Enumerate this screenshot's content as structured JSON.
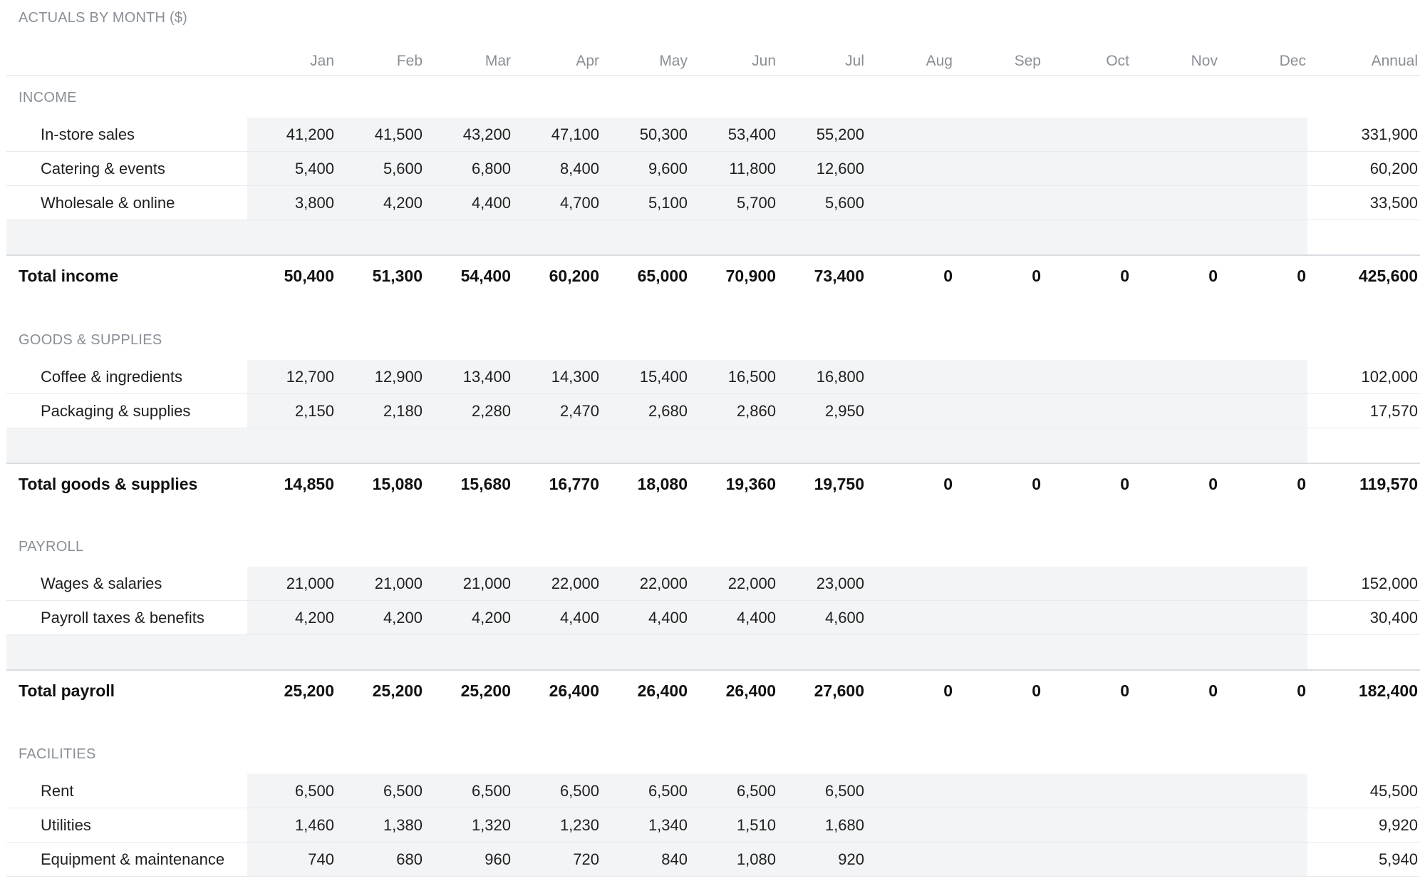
{
  "title": "ACTUALS BY MONTH ($)",
  "columns": [
    "Jan",
    "Feb",
    "Mar",
    "Apr",
    "May",
    "Jun",
    "Jul",
    "Aug",
    "Sep",
    "Oct",
    "Nov",
    "Dec",
    "Annual"
  ],
  "colors": {
    "muted_text": "#8a8f96",
    "input_band": "#f3f4f6",
    "text": "#1f1f1f"
  },
  "sections": [
    {
      "label": "INCOME",
      "rows": [
        {
          "label": "In-store sales",
          "values": [
            "41,200",
            "41,500",
            "43,200",
            "47,100",
            "50,300",
            "53,400",
            "55,200",
            "",
            "",
            "",
            "",
            ""
          ],
          "annual": "331,900"
        },
        {
          "label": "Catering & events",
          "values": [
            "5,400",
            "5,600",
            "6,800",
            "8,400",
            "9,600",
            "11,800",
            "12,600",
            "",
            "",
            "",
            "",
            ""
          ],
          "annual": "60,200"
        },
        {
          "label": "Wholesale & online",
          "values": [
            "3,800",
            "4,200",
            "4,400",
            "4,700",
            "5,100",
            "5,700",
            "5,600",
            "",
            "",
            "",
            "",
            ""
          ],
          "annual": "33,500"
        }
      ],
      "total": {
        "label": "Total income",
        "values": [
          "50,400",
          "51,300",
          "54,400",
          "60,200",
          "65,000",
          "70,900",
          "73,400",
          "0",
          "0",
          "0",
          "0",
          "0"
        ],
        "annual": "425,600"
      }
    },
    {
      "label": "GOODS & SUPPLIES",
      "rows": [
        {
          "label": "Coffee & ingredients",
          "values": [
            "12,700",
            "12,900",
            "13,400",
            "14,300",
            "15,400",
            "16,500",
            "16,800",
            "",
            "",
            "",
            "",
            ""
          ],
          "annual": "102,000"
        },
        {
          "label": "Packaging & supplies",
          "values": [
            "2,150",
            "2,180",
            "2,280",
            "2,470",
            "2,680",
            "2,860",
            "2,950",
            "",
            "",
            "",
            "",
            ""
          ],
          "annual": "17,570"
        }
      ],
      "total": {
        "label": "Total goods & supplies",
        "values": [
          "14,850",
          "15,080",
          "15,680",
          "16,770",
          "18,080",
          "19,360",
          "19,750",
          "0",
          "0",
          "0",
          "0",
          "0"
        ],
        "annual": "119,570"
      }
    },
    {
      "label": "PAYROLL",
      "rows": [
        {
          "label": "Wages & salaries",
          "values": [
            "21,000",
            "21,000",
            "21,000",
            "22,000",
            "22,000",
            "22,000",
            "23,000",
            "",
            "",
            "",
            "",
            ""
          ],
          "annual": "152,000"
        },
        {
          "label": "Payroll taxes & benefits",
          "values": [
            "4,200",
            "4,200",
            "4,200",
            "4,400",
            "4,400",
            "4,400",
            "4,600",
            "",
            "",
            "",
            "",
            ""
          ],
          "annual": "30,400"
        }
      ],
      "total": {
        "label": "Total payroll",
        "values": [
          "25,200",
          "25,200",
          "25,200",
          "26,400",
          "26,400",
          "26,400",
          "27,600",
          "0",
          "0",
          "0",
          "0",
          "0"
        ],
        "annual": "182,400"
      }
    },
    {
      "label": "FACILITIES",
      "rows": [
        {
          "label": "Rent",
          "values": [
            "6,500",
            "6,500",
            "6,500",
            "6,500",
            "6,500",
            "6,500",
            "6,500",
            "",
            "",
            "",
            "",
            ""
          ],
          "annual": "45,500"
        },
        {
          "label": "Utilities",
          "values": [
            "1,460",
            "1,380",
            "1,320",
            "1,230",
            "1,340",
            "1,510",
            "1,680",
            "",
            "",
            "",
            "",
            ""
          ],
          "annual": "9,920"
        },
        {
          "label": "Equipment & maintenance",
          "values": [
            "740",
            "680",
            "960",
            "720",
            "840",
            "1,080",
            "920",
            "",
            "",
            "",
            "",
            ""
          ],
          "annual": "5,940"
        }
      ]
    }
  ]
}
